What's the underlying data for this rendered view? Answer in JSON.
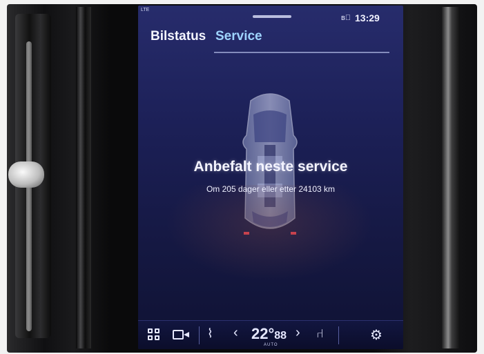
{
  "status_bar": {
    "left_indicator": "LTE",
    "bt_indicator": "ᴮ᷊ᴼ",
    "time": "13:29"
  },
  "tabs": [
    {
      "label": "Bilstatus",
      "active": false
    },
    {
      "label": "Service",
      "active": true
    }
  ],
  "service": {
    "title": "Anbefalt neste service",
    "detail": "Om 205 dager eller etter 24103 km"
  },
  "climate_bar": {
    "temperature": "22°",
    "fan_glyph": "88",
    "mode": "AUTO",
    "left_arrow": "‹",
    "right_arrow": "›"
  },
  "colors": {
    "screen_bg": "#1c2057",
    "active_tab": "#9fd4ff",
    "text": "#f4f5ff"
  },
  "icons": [
    "grid-icon",
    "camera-icon",
    "seat-heat-icon",
    "seat-icon",
    "gear-icon",
    "car-icon"
  ]
}
